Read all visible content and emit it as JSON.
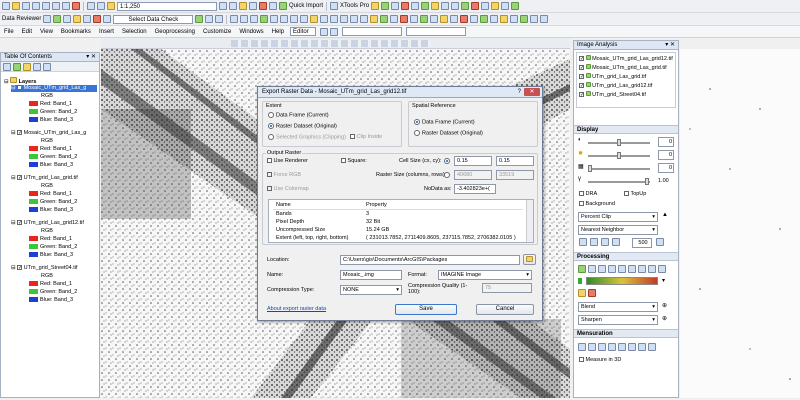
{
  "toolbar1": {
    "scale": "1:1,250",
    "quick_import": "Quick Import",
    "xtools": "XTools Pro"
  },
  "toolbar2": {
    "data_reviewer": "Data Reviewer",
    "select_data_check": "Select Data Check",
    "editor": "Editor"
  },
  "menu": [
    "File",
    "Edit",
    "View",
    "Bookmarks",
    "Insert",
    "Selection",
    "Geoprocessing",
    "Customize",
    "Windows",
    "Help"
  ],
  "toc": {
    "title": "Table Of Contents",
    "root": "Layers",
    "layers": [
      {
        "name": "Mosaic_UTm_grid_Las_g",
        "rgb": "RGB",
        "bands": [
          "Red:   Band_1",
          "Green: Band_2",
          "Blue:  Band_3"
        ]
      },
      {
        "name": "Mosaic_UTm_grid_Las_g",
        "rgb": "RGB",
        "bands": [
          "Red:   Band_1",
          "Green: Band_2",
          "Blue:  Band_3"
        ]
      },
      {
        "name": "UTm_grid_Las_grid.tif",
        "rgb": "RGB",
        "bands": [
          "Red:   Band_1",
          "Green: Band_2",
          "Blue:  Band_3"
        ]
      },
      {
        "name": "UTm_grid_Las_grid12.tif",
        "rgb": "RGB",
        "bands": [
          "Red:   Band_1",
          "Green: Band_2",
          "Blue:  Band_3"
        ]
      },
      {
        "name": "UTm_grid_Street04.tif",
        "rgb": "RGB",
        "bands": [
          "Red:   Band_1",
          "Green: Band_2",
          "Blue:  Band_3"
        ]
      }
    ]
  },
  "dialog": {
    "title": "Export Raster Data - Mosaic_UTm_grid_Las_grid12.tif",
    "extent_label": "Extent",
    "extent_opts": [
      "Data Frame (Current)",
      "Raster Dataset (Original)",
      "Selected Graphics (Clipping)"
    ],
    "clip_inside": "Clip Inside",
    "spatial_ref_label": "Spatial Reference",
    "spatial_opts": [
      "Data Frame (Current)",
      "Raster Dataset (Original)"
    ],
    "output_raster_label": "Output Raster",
    "use_renderer": "Use Renderer",
    "force_rgb": "Force RGB",
    "use_colormap": "Use Colormap",
    "square": "Square:",
    "cell_size_label": "Cell Size (cx, cy):",
    "cell_cx": "0.15",
    "cell_cy": "0.15",
    "raster_size_label": "Raster Size (columns, rows):",
    "cols": "40680",
    "rows": "33519",
    "nodata_label": "NoData as:",
    "nodata": "-3.402823e+(",
    "table_headers": [
      "Name",
      "Property"
    ],
    "table_rows": [
      [
        "Bands",
        "3"
      ],
      [
        "Pixel Depth",
        "32 Bit"
      ],
      [
        "Uncompressed Size",
        "15.24 GB"
      ],
      [
        "Extent (left, top, right, bottom)",
        "( 231013.7852, 2711409.8605, 237115.7852, 2706382.0105 )"
      ]
    ],
    "location_label": "Location:",
    "location": "C:\\Users\\gis\\Documents\\ArcGIS\\Packages",
    "name_label": "Name:",
    "name": "Mosaic_.img",
    "format_label": "Format:",
    "format": "IMAGINE Image",
    "compression_label": "Compression Type:",
    "compression": "NONE",
    "quality_label": "Compression Quality (1-100):",
    "quality": "75",
    "about_link": "About export raster data",
    "save": "Save",
    "cancel": "Cancel"
  },
  "image_analysis": {
    "title": "Image Analysis",
    "layers": [
      "Mosaic_UTm_grid_Las_grid12.tif",
      "Mosaic_UTm_grid_Las_grid.tif",
      "UTm_grid_Las_grid.tif",
      "UTm_grid_Las_grid12.tif",
      "UTm_grid_Street04.tif"
    ],
    "display_label": "Display",
    "values": [
      "0",
      "0",
      "0",
      "1.00"
    ],
    "dra": "DRA",
    "topup": "TopUp",
    "background": "Background",
    "stretch": "Percent Clip",
    "resample": "Nearest Neighbor",
    "zoom_value": "500",
    "processing_label": "Processing",
    "blend": "Blend",
    "sharpen": "Sharpen",
    "mensuration_label": "Mensuration",
    "measure_3d": "Measure in 3D"
  }
}
